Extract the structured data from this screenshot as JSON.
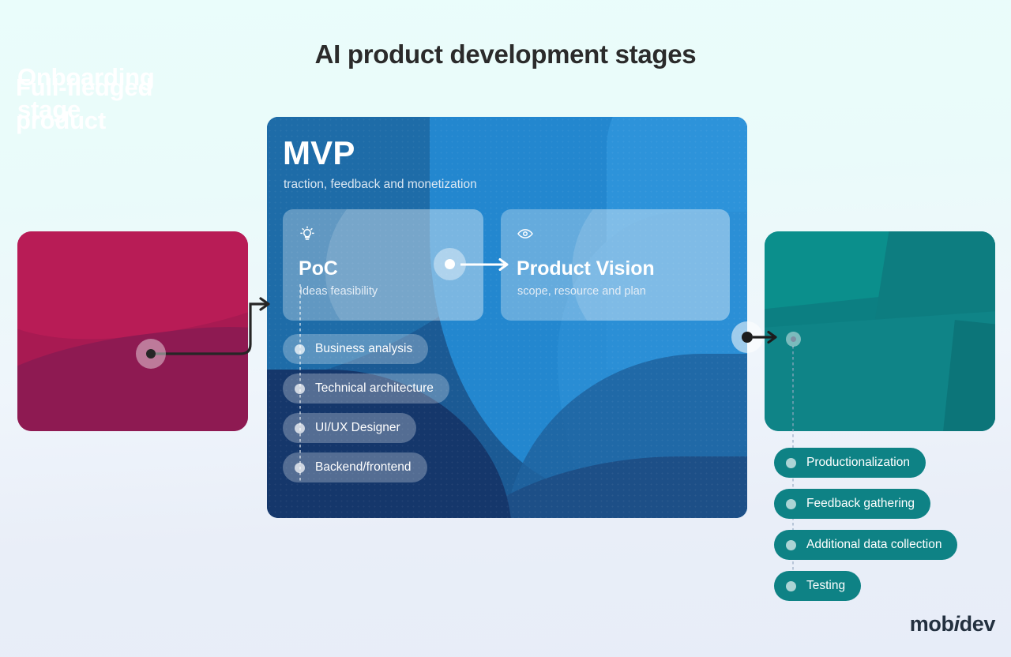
{
  "page": {
    "title": "AI product development stages",
    "background_top": "#eafbfa",
    "background_bottom": "#e7edf8"
  },
  "onboarding": {
    "label": "Onboarding stage",
    "color": "#a81a52",
    "node_icon": "connector-node"
  },
  "mvp": {
    "title": "MVP",
    "subtitle": "traction, feedback and monetization",
    "color": "#1e6ca8",
    "features": [
      {
        "icon": "lightbulb-icon",
        "name": "PoC",
        "subtitle": "Ideas feasibility"
      },
      {
        "icon": "eye-icon",
        "name": "Product Vision",
        "subtitle": "scope, resource and plan"
      }
    ],
    "pills": [
      "Business analysis",
      "Technical architecture",
      "UI/UX Designer",
      "Backend/frontend"
    ]
  },
  "product": {
    "label": "Full-fledged product",
    "color": "#0c7f82",
    "pills": [
      "Productionalization",
      "Feedback gathering",
      "Additional data collection",
      "Testing"
    ]
  },
  "logo": {
    "part1": "mob",
    "italic": "i",
    "part2": "dev"
  }
}
